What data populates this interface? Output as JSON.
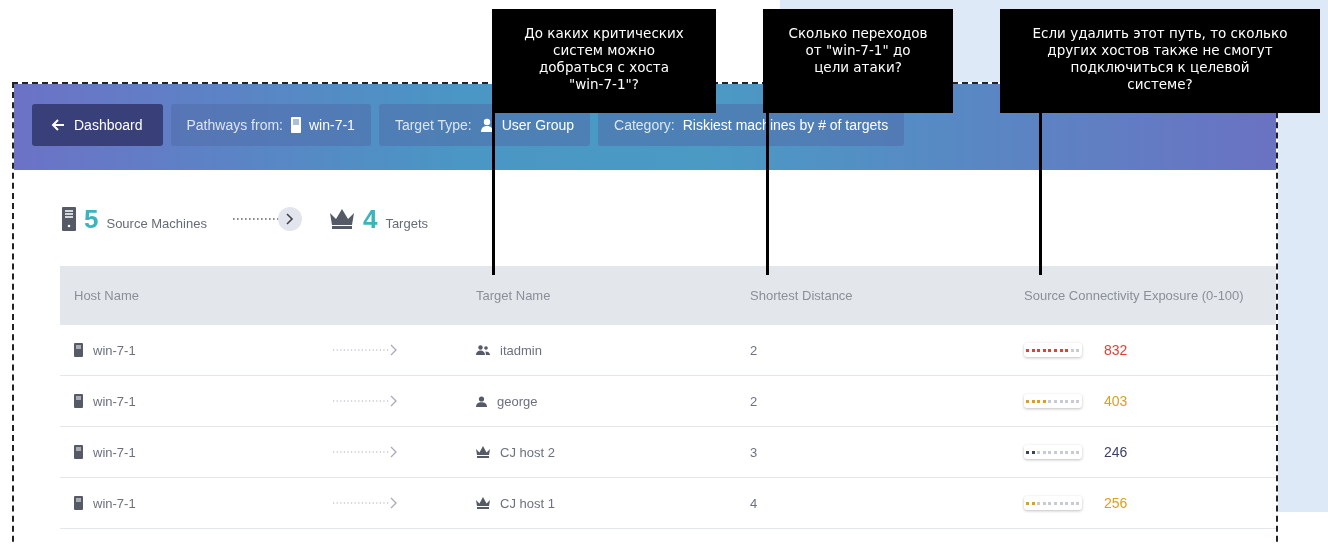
{
  "callouts": [
    {
      "text": "До каких критических\nсистем можно\nдобраться с хоста\n\"win-7-1\"?"
    },
    {
      "text": "Сколько переходов\nот \"win-7-1\" до\nцели атаки?"
    },
    {
      "text": "Если удалить этот путь, то сколько\nдругих хостов также не смогут\nподключиться к целевой\nсистеме?"
    }
  ],
  "toolbar": {
    "back_button": "Dashboard",
    "filters": [
      {
        "label": "Pathways from:",
        "value": "win-7-1",
        "kind": "server"
      },
      {
        "label": "Target Type:",
        "value": "User Group",
        "kind": "user"
      },
      {
        "label": "Category:",
        "value": "Riskiest machines by # of targets",
        "kind": "none"
      }
    ]
  },
  "summary": {
    "sources_count": "5",
    "sources_label": "Source Machines",
    "targets_count": "4",
    "targets_label": "Targets"
  },
  "table": {
    "columns": [
      "Host Name",
      "Target Name",
      "Shortest Distance",
      "Source Connectivity Exposure (0-100)"
    ],
    "rows": [
      {
        "host": "win-7-1",
        "target": "itadmin",
        "kind": "group",
        "distance": "2",
        "level": 0.8,
        "color": "#e0403a",
        "exposure": "832"
      },
      {
        "host": "win-7-1",
        "target": "george",
        "kind": "user",
        "distance": "2",
        "level": 0.4,
        "color": "#d9a021",
        "exposure": "403"
      },
      {
        "host": "win-7-1",
        "target": "CJ host 2",
        "kind": "crown",
        "distance": "3",
        "level": 0.2,
        "color": "#3b3f6b",
        "exposure": "246"
      },
      {
        "host": "win-7-1",
        "target": "CJ host 1",
        "kind": "crown",
        "distance": "4",
        "level": 0.2,
        "color": "#d9a021",
        "exposure": "256"
      }
    ]
  }
}
